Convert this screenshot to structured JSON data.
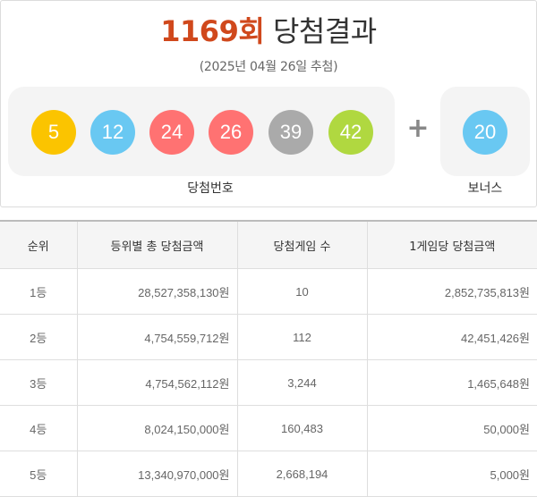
{
  "header": {
    "round": "1169회",
    "title": "당첨결과",
    "date": "(2025년 04월 26일 추첨)"
  },
  "winning_numbers": [
    {
      "value": "5",
      "color": "#fbc400"
    },
    {
      "value": "12",
      "color": "#69c8f2"
    },
    {
      "value": "24",
      "color": "#ff7272"
    },
    {
      "value": "26",
      "color": "#ff7272"
    },
    {
      "value": "39",
      "color": "#aaaaaa"
    },
    {
      "value": "42",
      "color": "#b0d840"
    }
  ],
  "plus_sign": "+",
  "bonus": {
    "value": "20",
    "color": "#69c8f2"
  },
  "labels": {
    "winning": "당첨번호",
    "bonus": "보너스"
  },
  "table": {
    "headers": [
      "순위",
      "등위별 총 당첨금액",
      "당첨게임 수",
      "1게임당 당첨금액"
    ],
    "rows": [
      [
        "1등",
        "28,527,358,130원",
        "10",
        "2,852,735,813원"
      ],
      [
        "2등",
        "4,754,559,712원",
        "112",
        "42,451,426원"
      ],
      [
        "3등",
        "4,754,562,112원",
        "3,244",
        "1,465,648원"
      ],
      [
        "4등",
        "8,024,150,000원",
        "160,483",
        "50,000원"
      ],
      [
        "5등",
        "13,340,970,000원",
        "2,668,194",
        "5,000원"
      ]
    ]
  }
}
